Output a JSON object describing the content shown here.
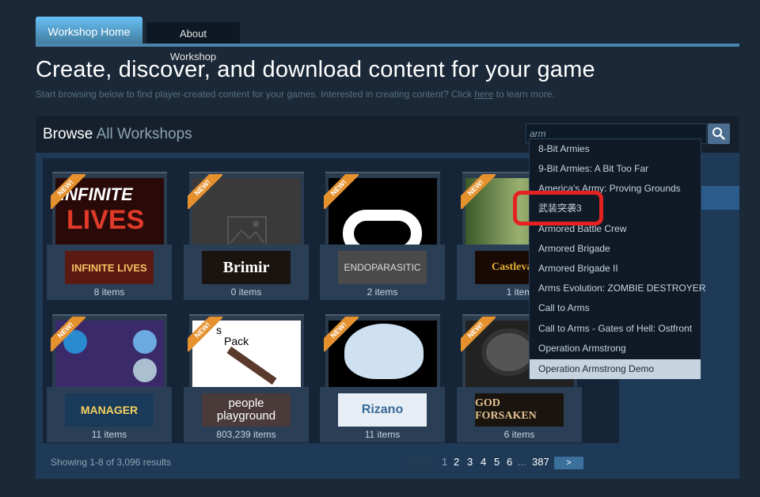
{
  "tabs": {
    "home": "Workshop Home",
    "about": "About Workshop"
  },
  "hero": {
    "title": "Create, discover, and download content for your game",
    "subtitle_before": "Start browsing below to find player-created content for your games. Interested in creating content? Click ",
    "subtitle_link": "here",
    "subtitle_after": " to learn more."
  },
  "browse": {
    "title_bold": "Browse",
    "title_dim": " All Workshops"
  },
  "search": {
    "value": "arm"
  },
  "cards": [
    {
      "thumb": "INFINITE LIVES",
      "count": "8 items"
    },
    {
      "thumb": "Brimir",
      "count": "0 items"
    },
    {
      "thumb": "ENDOPARASITIC",
      "count": "2 items"
    },
    {
      "thumb": "Castlevania",
      "count": "1 item"
    },
    {
      "thumb": "MANAGER",
      "count": "11 items"
    },
    {
      "thumb": "people playground",
      "count": "803,239 items"
    },
    {
      "thumb": "Rizano",
      "count": "11 items"
    },
    {
      "thumb": "GOD FORSAKEN",
      "count": "6 items"
    }
  ],
  "card_art_text": {
    "lives_title": "INFINITE",
    "lives_sub": "LIVES",
    "people_text": "Pack",
    "people_line1": "s"
  },
  "new_label": "NEW!",
  "dropdown": [
    "8-Bit Armies",
    "9-Bit Armies: A Bit Too Far",
    "America's Army: Proving Grounds",
    "武装突袭3",
    "Armored Battle Crew",
    "Armored Brigade",
    "Armored Brigade II",
    "Arms Evolution: ZOMBIE DESTROYER",
    "Call to Arms",
    "Call to Arms - Gates of Hell: Ostfront",
    "Operation Armstrong",
    "Operation Armstrong Demo"
  ],
  "footer": {
    "showing": "Showing 1-8 of 3,096 results"
  },
  "pagination": {
    "pages": [
      "1",
      "2",
      "3",
      "4",
      "5",
      "6",
      "...",
      "387"
    ],
    "next": ">"
  },
  "colors": {
    "accent": "#67c1f5",
    "new_badge": "#e5912e",
    "annotation": "#e52222"
  },
  "icons": {
    "search": "search-icon",
    "placeholder": "image-placeholder-icon"
  }
}
